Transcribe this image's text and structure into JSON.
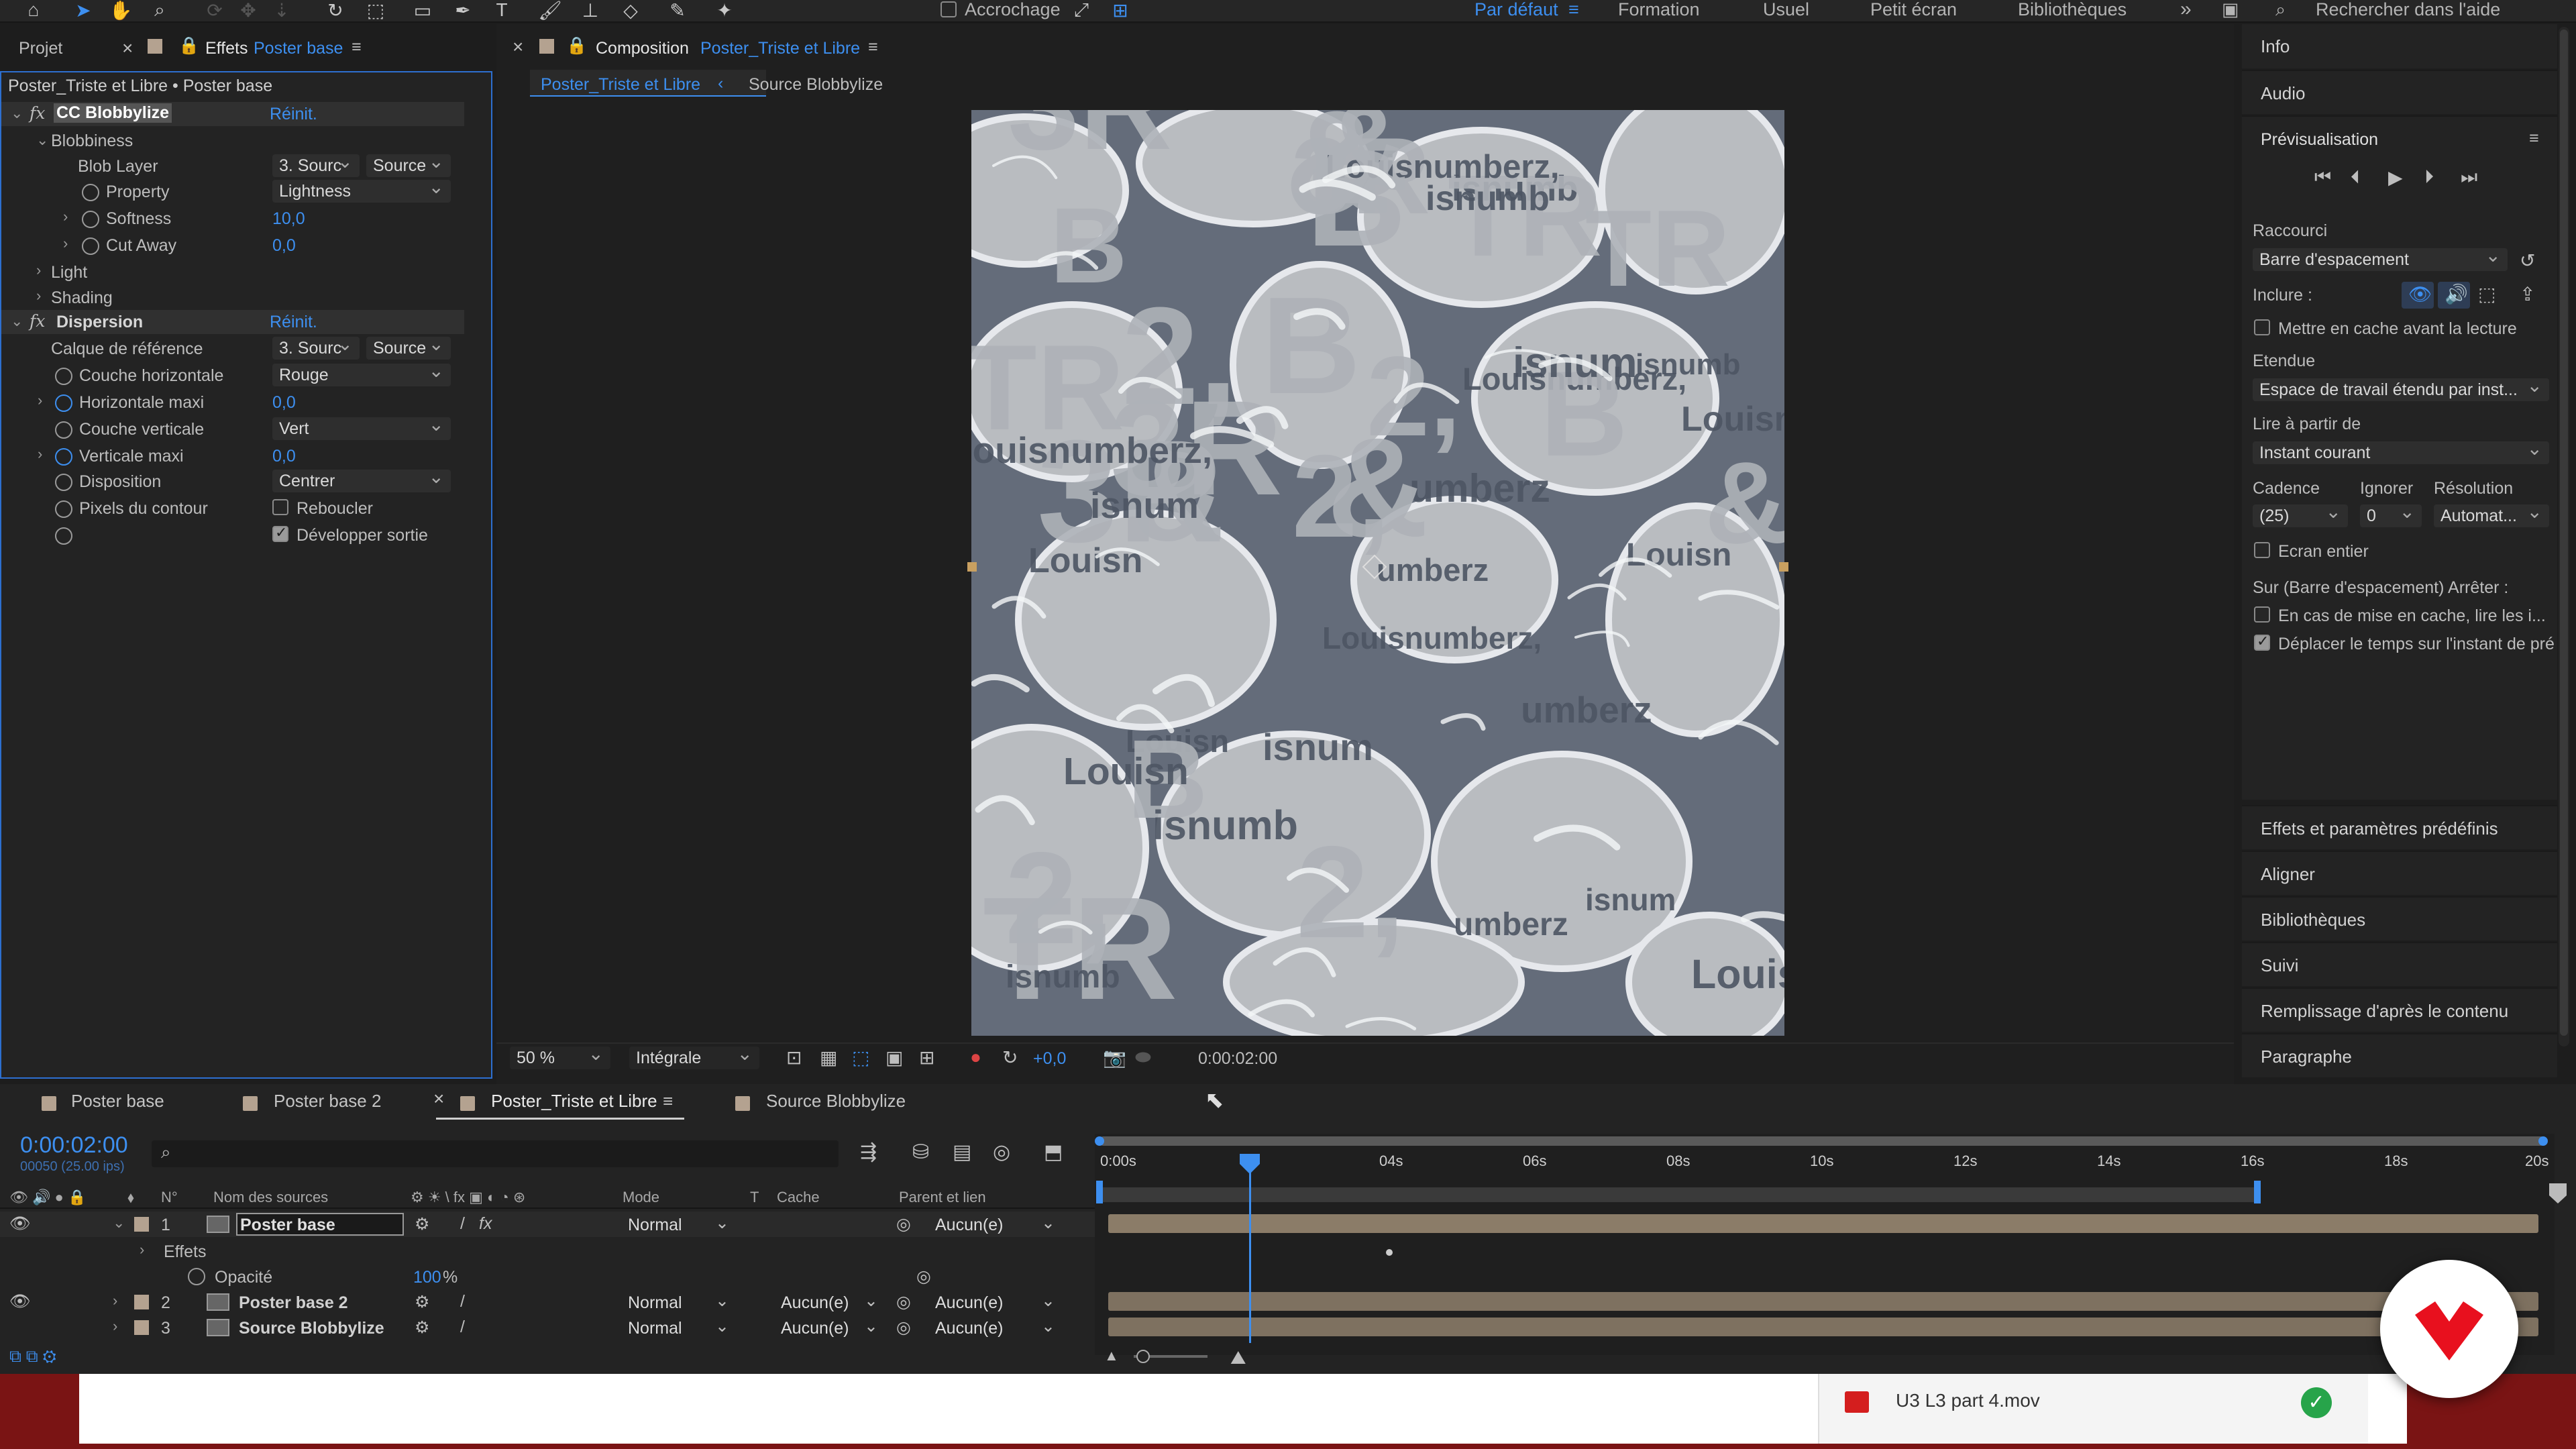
{
  "toolbar": {
    "tools": [
      "home-icon",
      "selection-icon",
      "hand-icon",
      "zoom-icon",
      "orbit-icon",
      "move-icon",
      "dolly-icon",
      "rotate-icon",
      "pan-behind-icon",
      "rectangle-icon",
      "pen-icon",
      "text-icon",
      "brush-icon",
      "clone-stamp-icon",
      "eraser-icon",
      "roto-brush-icon",
      "puppet-icon"
    ],
    "snapping_label": "Accrochage",
    "workspaces": [
      "Par défaut",
      "Formation",
      "Usuel",
      "Petit écran",
      "Bibliothèques"
    ],
    "active_workspace": "Par défaut",
    "search_placeholder": "Rechercher dans l'aide"
  },
  "effects_panel": {
    "tab_project": "Projet",
    "tab_effects": "Effets",
    "tab_effects_layer": "Poster base",
    "path": "Poster_Triste et Libre • Poster base",
    "blobbylize": {
      "name": "CC Blobbylize",
      "reset": "Réinit.",
      "blobbiness": "Blobbiness",
      "blob_layer_label": "Blob Layer",
      "blob_layer_value": "3. Sourc",
      "blob_layer_source": "Source",
      "property_label": "Property",
      "property_value": "Lightness",
      "softness_label": "Softness",
      "softness_value": "10,0",
      "cut_away_label": "Cut Away",
      "cut_away_value": "0,0",
      "light": "Light",
      "shading": "Shading"
    },
    "dispersion": {
      "name": "Dispersion",
      "reset": "Réinit.",
      "ref_layer_label": "Calque de référence",
      "ref_layer_value": "3. Sourc",
      "ref_layer_source": "Source",
      "h_channel_label": "Couche horizontale",
      "h_channel_value": "Rouge",
      "h_max_label": "Horizontale maxi",
      "h_max_value": "0,0",
      "v_channel_label": "Couche verticale",
      "v_channel_value": "Vert",
      "v_max_label": "Verticale maxi",
      "v_max_value": "0,0",
      "layout_label": "Disposition",
      "layout_value": "Centrer",
      "edge_label": "Pixels du contour",
      "wrap_label": "Reboucler",
      "expand_label": "Développer sortie"
    }
  },
  "composition": {
    "tab_label": "Composition",
    "tab_name": "Poster_Triste et Libre",
    "breadcrumb_active": "Poster_Triste et Libre",
    "breadcrumb_next": "Source Blobbylize",
    "poster_words": [
      "Louisnumberz,",
      "&",
      "2,",
      "B",
      "isnumb",
      "Louisn",
      "umberz",
      "TR",
      "3R",
      "isnum"
    ],
    "zoom": "50 %",
    "resolution": "Intégrale",
    "exposure": "+0,0",
    "timecode": "0:00:02:00"
  },
  "right_panel": {
    "info": "Info",
    "audio": "Audio",
    "preview_title": "Prévisualisation",
    "shortcut_label": "Raccourci",
    "shortcut_value": "Barre d'espacement",
    "include_label": "Inclure :",
    "cache_before": "Mettre en cache avant la lecture",
    "range_label": "Etendue",
    "range_value": "Espace de travail étendu par inst...",
    "play_from_label": "Lire à partir de",
    "play_from_value": "Instant courant",
    "framerate_label": "Cadence",
    "skip_label": "Ignorer",
    "resolution_label": "Résolution",
    "framerate_value": "(25)",
    "skip_value": "0",
    "resolution_value": "Automat...",
    "fullscreen": "Ecran entier",
    "on_stop": "Sur (Barre d'espacement) Arrêter :",
    "if_caching": "En cas de mise en cache, lire les i...",
    "move_time": "Déplacer le temps sur l'instant de pré",
    "sections": [
      "Effets et paramètres prédéfinis",
      "Aligner",
      "Bibliothèques",
      "Suivi",
      "Remplissage d'après le contenu",
      "Paragraphe"
    ]
  },
  "timeline": {
    "tabs": [
      "Poster base",
      "Poster base 2",
      "Poster_Triste et Libre",
      "Source Blobbylize"
    ],
    "active_tab": "Poster_Triste et Libre",
    "timecode": "0:00:02:00",
    "frame_info": "00050 (25.00 ips)",
    "col_num": "N°",
    "col_source": "Nom des sources",
    "col_mode": "Mode",
    "col_t": "T",
    "col_cache": "Cache",
    "col_parent": "Parent et lien",
    "ruler": [
      "0:00s",
      "04s",
      "06s",
      "08s",
      "10s",
      "12s",
      "14s",
      "16s",
      "18s",
      "20s"
    ],
    "layers": [
      {
        "num": "1",
        "name": "Poster base",
        "mode": "Normal",
        "cache": "",
        "parent": "Aucun(e)"
      },
      {
        "num": "2",
        "name": "Poster base 2",
        "mode": "Normal",
        "cache": "Aucun(e)",
        "parent": "Aucun(e)"
      },
      {
        "num": "3",
        "name": "Source Blobbylize",
        "mode": "Normal",
        "cache": "Aucun(e)",
        "parent": "Aucun(e)"
      }
    ],
    "effects_row": "Effets",
    "opacity_label": "Opacité",
    "opacity_value": "100",
    "opacity_unit": "%"
  },
  "notification": {
    "filename": "U3 L3 part 4.mov"
  },
  "colors": {
    "accent": "#3d8ff0",
    "label_tan": "#b4a290",
    "layer_bar": "#8b7c68",
    "brand_red": "#e8101e",
    "footer_red": "#7a1414"
  }
}
